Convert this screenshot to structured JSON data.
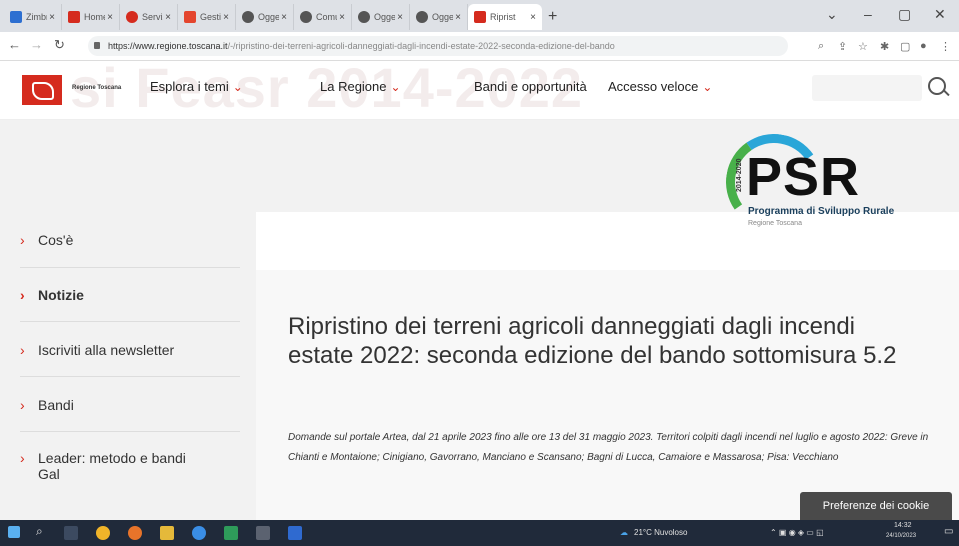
{
  "browser": {
    "tabs": [
      {
        "label": "Zimbra",
        "color": "#2d6fd1"
      },
      {
        "label": "Home",
        "color": "#d52b1e"
      },
      {
        "label": "Servizi",
        "color": "#d52b1e"
      },
      {
        "label": "Gestio",
        "color": "#e4452e"
      },
      {
        "label": "Oggett",
        "color": "#555555"
      },
      {
        "label": "Comun",
        "color": "#555555"
      },
      {
        "label": "Oggett",
        "color": "#555555"
      },
      {
        "label": "Oggett",
        "color": "#555555"
      },
      {
        "label": "Riprist",
        "color": "#d52b1e"
      }
    ],
    "url_host": "https://www.regione.toscana.it",
    "url_path": "/-/ripristino-dei-terreni-agricoli-danneggiati-dagli-incendi-estate-2022-seconda-edizione-del-bando"
  },
  "header": {
    "logo_text": "Regione Toscana",
    "ghost_text": "si Feasr 2014-2022",
    "menu": [
      "Esplora i temi",
      "La Regione",
      "Bandi e opportunità",
      "Accesso veloce"
    ]
  },
  "psr": {
    "big": "PSR",
    "years": "2014-2020",
    "subtitle": "Programma di Sviluppo Rurale",
    "region": "Regione Toscana"
  },
  "sidebar": {
    "items": [
      {
        "label": "Cos'è"
      },
      {
        "label": "Notizie"
      },
      {
        "label": "Iscriviti alla newsletter"
      },
      {
        "label": "Bandi"
      },
      {
        "label": "Leader: metodo e bandi Gal"
      }
    ]
  },
  "article": {
    "title": "Ripristino dei terreni agricoli danneggiati dagli incendi estate 2022: seconda edizione del bando sottomisura 5.2",
    "lead": "Domande sul portale Artea, dal 21 aprile 2023 fino alle ore 13 del 31 maggio 2023. Territori colpiti dagli incendi nel luglio e agosto 2022: Greve in Chianti e Montaione; Cinigiano, Gavorrano, Manciano e Scansano; Bagni di Lucca, Camaiore e Massarosa; Pisa: Vecchiano"
  },
  "cookie_label": "Preferenze dei cookie",
  "taskbar": {
    "weather": "21°C Nuvoloso",
    "time": "14:32",
    "date": "24/10/2023"
  }
}
